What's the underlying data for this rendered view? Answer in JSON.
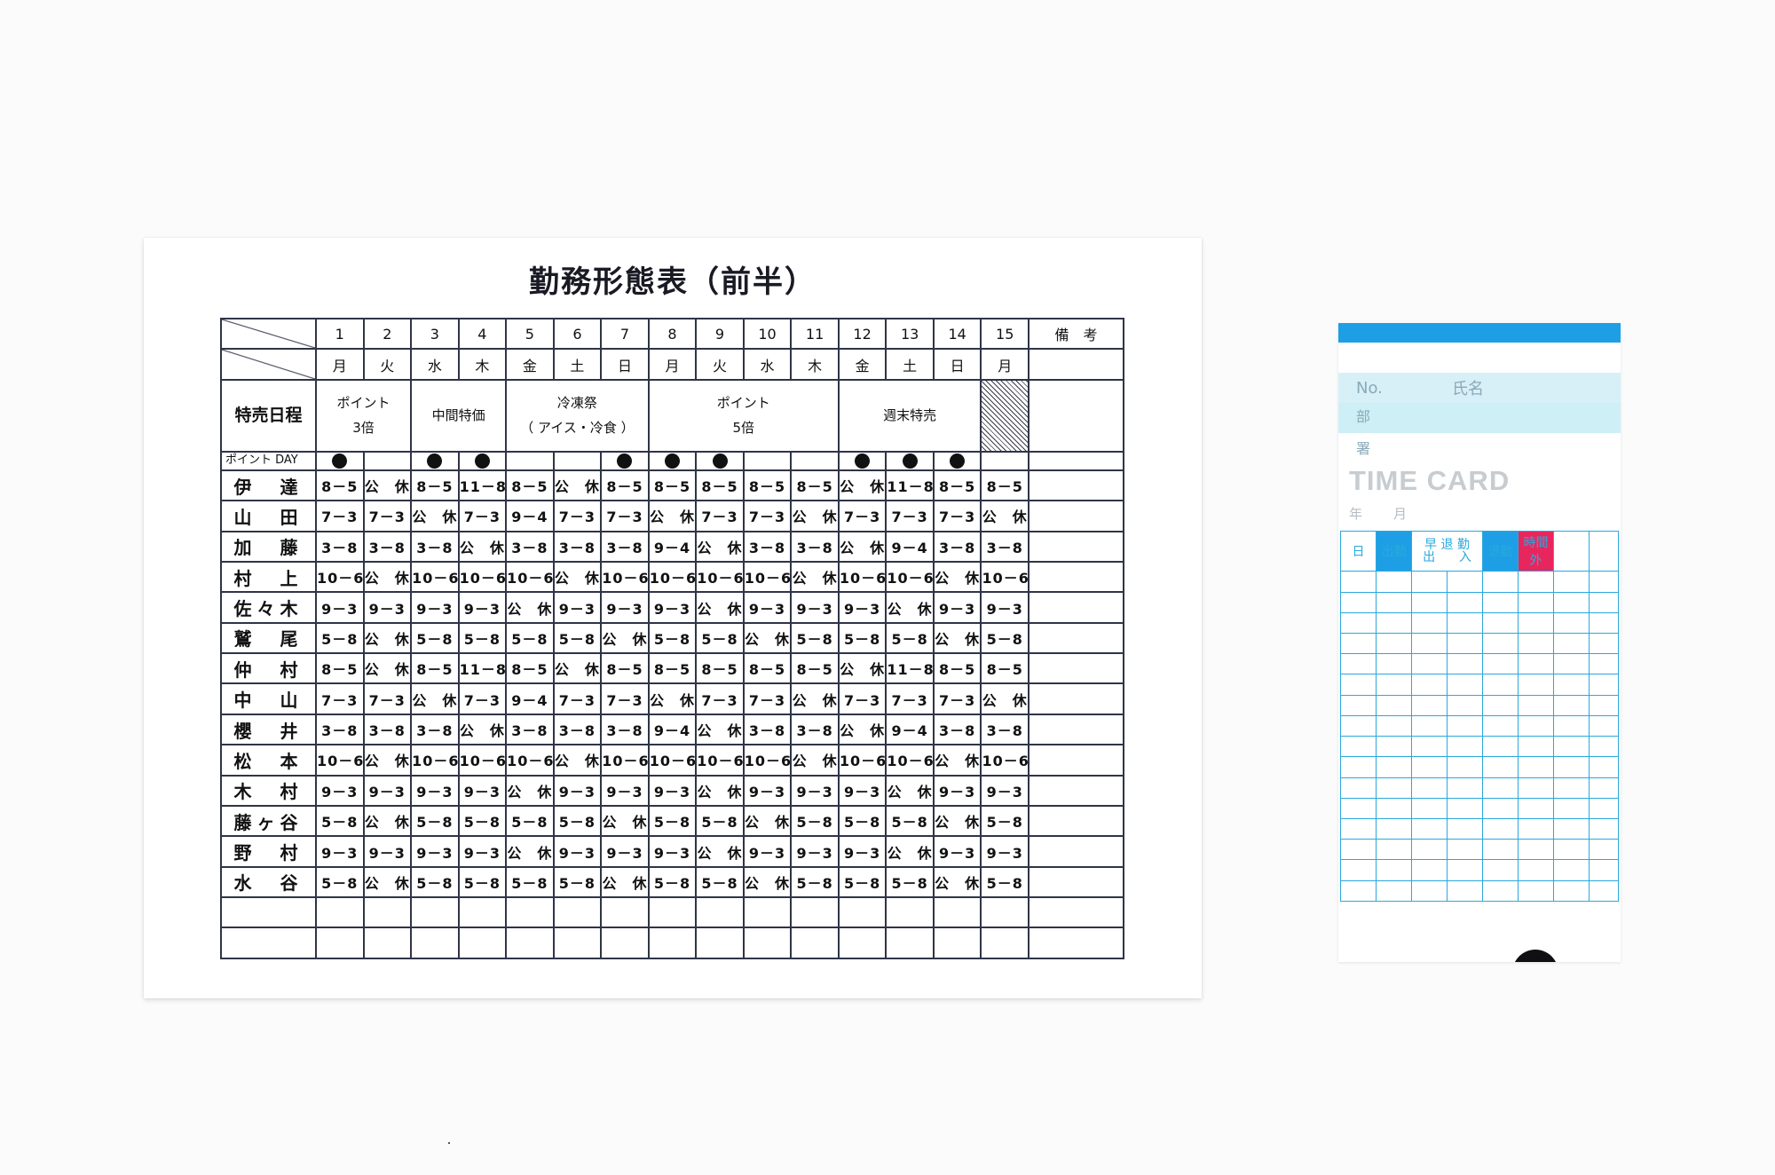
{
  "sheet": {
    "title": "勤務形態表（前半）",
    "days": [
      "1",
      "2",
      "3",
      "4",
      "5",
      "6",
      "7",
      "8",
      "9",
      "10",
      "11",
      "12",
      "13",
      "14",
      "15"
    ],
    "dows": [
      "月",
      "火",
      "水",
      "木",
      "金",
      "土",
      "日",
      "月",
      "火",
      "水",
      "木",
      "金",
      "土",
      "日",
      "月"
    ],
    "remarks_label": "備　考",
    "event_label": "特売日程",
    "events": [
      {
        "line1": "ポイント",
        "line2": "3倍"
      },
      {
        "line1": "中間特価",
        "line2": ""
      },
      {
        "line1": "冷凍祭",
        "line2": "（ アイス・冷食 ）"
      },
      {
        "line1": "ポイント",
        "line2": "5倍"
      },
      {
        "line1": "週末特売",
        "line2": ""
      }
    ],
    "point_day_label": "ポイント DAY",
    "point_day_mark": "●",
    "point_days": [
      true,
      false,
      true,
      true,
      false,
      false,
      true,
      true,
      true,
      false,
      false,
      true,
      true,
      true,
      false
    ],
    "staff": [
      {
        "name": "伊　達",
        "shifts": [
          "8－5",
          "公　休",
          "8－5",
          "11－8",
          "8－5",
          "公　休",
          "8－5",
          "8－5",
          "8－5",
          "8－5",
          "8－5",
          "公　休",
          "11－8",
          "8－5",
          "8－5"
        ]
      },
      {
        "name": "山　田",
        "shifts": [
          "7－3",
          "7－3",
          "公　休",
          "7－3",
          "9－4",
          "7－3",
          "7－3",
          "公　休",
          "7－3",
          "7－3",
          "公　休",
          "7－3",
          "7－3",
          "7－3",
          "公　休"
        ]
      },
      {
        "name": "加　藤",
        "shifts": [
          "3－8",
          "3－8",
          "3－8",
          "公　休",
          "3－8",
          "3－8",
          "3－8",
          "9－4",
          "公　休",
          "3－8",
          "3－8",
          "公　休",
          "9－4",
          "3－8",
          "3－8"
        ]
      },
      {
        "name": "村　上",
        "shifts": [
          "10－6",
          "公　休",
          "10－6",
          "10－6",
          "10－6",
          "公　休",
          "10－6",
          "10－6",
          "10－6",
          "10－6",
          "公　休",
          "10－6",
          "10－6",
          "公　休",
          "10－6"
        ]
      },
      {
        "name": "佐々木",
        "shifts": [
          "9－3",
          "9－3",
          "9－3",
          "9－3",
          "公　休",
          "9－3",
          "9－3",
          "9－3",
          "公　休",
          "9－3",
          "9－3",
          "9－3",
          "公　休",
          "9－3",
          "9－3"
        ]
      },
      {
        "name": "鷲　尾",
        "shifts": [
          "5－8",
          "公　休",
          "5－8",
          "5－8",
          "5－8",
          "5－8",
          "公　休",
          "5－8",
          "5－8",
          "公　休",
          "5－8",
          "5－8",
          "5－8",
          "公　休",
          "5－8"
        ]
      },
      {
        "name": "仲　村",
        "shifts": [
          "8－5",
          "公　休",
          "8－5",
          "11－8",
          "8－5",
          "公　休",
          "8－5",
          "8－5",
          "8－5",
          "8－5",
          "8－5",
          "公　休",
          "11－8",
          "8－5",
          "8－5"
        ]
      },
      {
        "name": "中　山",
        "shifts": [
          "7－3",
          "7－3",
          "公　休",
          "7－3",
          "9－4",
          "7－3",
          "7－3",
          "公　休",
          "7－3",
          "7－3",
          "公　休",
          "7－3",
          "7－3",
          "7－3",
          "公　休"
        ]
      },
      {
        "name": "櫻　井",
        "shifts": [
          "3－8",
          "3－8",
          "3－8",
          "公　休",
          "3－8",
          "3－8",
          "3－8",
          "9－4",
          "公　休",
          "3－8",
          "3－8",
          "公　休",
          "9－4",
          "3－8",
          "3－8"
        ]
      },
      {
        "name": "松　本",
        "shifts": [
          "10－6",
          "公　休",
          "10－6",
          "10－6",
          "10－6",
          "公　休",
          "10－6",
          "10－6",
          "10－6",
          "10－6",
          "公　休",
          "10－6",
          "10－6",
          "公　休",
          "10－6"
        ]
      },
      {
        "name": "木　村",
        "shifts": [
          "9－3",
          "9－3",
          "9－3",
          "9－3",
          "公　休",
          "9－3",
          "9－3",
          "9－3",
          "公　休",
          "9－3",
          "9－3",
          "9－3",
          "公　休",
          "9－3",
          "9－3"
        ]
      },
      {
        "name": "藤ヶ谷",
        "shifts": [
          "5－8",
          "公　休",
          "5－8",
          "5－8",
          "5－8",
          "5－8",
          "公　休",
          "5－8",
          "5－8",
          "公　休",
          "5－8",
          "5－8",
          "5－8",
          "公　休",
          "5－8"
        ]
      },
      {
        "name": "野　村",
        "shifts": [
          "9－3",
          "9－3",
          "9－3",
          "9－3",
          "公　休",
          "9－3",
          "9－3",
          "9－3",
          "公　休",
          "9－3",
          "9－3",
          "9－3",
          "公　休",
          "9－3",
          "9－3"
        ]
      },
      {
        "name": "水　谷",
        "shifts": [
          "5－8",
          "公　休",
          "5－8",
          "5－8",
          "5－8",
          "5－8",
          "公　休",
          "5－8",
          "5－8",
          "公　休",
          "5－8",
          "5－8",
          "5－8",
          "公　休",
          "5－8"
        ]
      }
    ]
  },
  "time_card": {
    "no_label": "No.",
    "name_label": "氏名",
    "dept_label_1": "部",
    "dept_label_2": "署",
    "title": "TIME CARD",
    "year_label": "年",
    "month_label": "月",
    "col_day": "日",
    "col_in": "出勤",
    "col_early": "早 退 勤",
    "col_out_sub": "出",
    "col_in_sub": "入",
    "col_out": "退勤",
    "col_overtime": "時間外",
    "colors": {
      "header_bar": "#1e9fe5",
      "grid": "#2aa8dc",
      "overtime": "#e8265e",
      "dept_band": "#d7f0f7"
    }
  }
}
